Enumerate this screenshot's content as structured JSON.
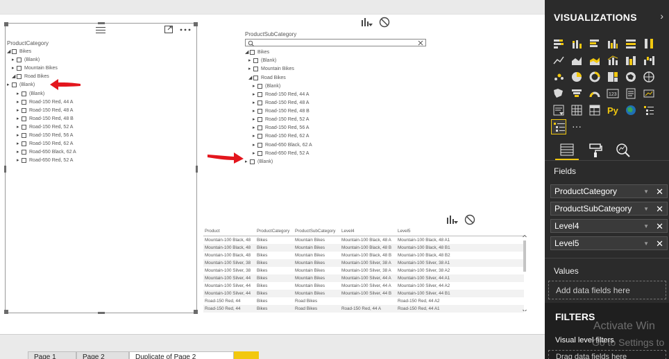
{
  "slicer1": {
    "title": "ProductCategory",
    "rows": [
      {
        "label": "Bikes",
        "caret": "◢"
      },
      {
        "label": "(Blank)",
        "caret": "▸"
      },
      {
        "label": "Mountain Bikes",
        "caret": "▸"
      },
      {
        "label": "Road Bikes",
        "caret": "◢"
      },
      {
        "label": "(Blank)",
        "caret": "▸"
      },
      {
        "label": "(Blank)",
        "caret": "▸"
      },
      {
        "label": "Road-150 Red, 44 A",
        "caret": "▸"
      },
      {
        "label": "Road-150 Red, 48 A",
        "caret": "▸"
      },
      {
        "label": "Road-150 Red, 48 B",
        "caret": "▸"
      },
      {
        "label": "Road-150 Red, 52 A",
        "caret": "▸"
      },
      {
        "label": "Road-150 Red, 56 A",
        "caret": "▸"
      },
      {
        "label": "Road-150 Red, 62 A",
        "caret": "▸"
      },
      {
        "label": "Road-650 Black, 62 A",
        "caret": "▸"
      },
      {
        "label": "Road-650 Red, 52 A",
        "caret": "▸"
      }
    ]
  },
  "slicer2": {
    "title": "ProductSubCategory",
    "search_placeholder": "",
    "rows": [
      {
        "label": "Bikes",
        "caret": "◢"
      },
      {
        "label": "(Blank)",
        "caret": "▸"
      },
      {
        "label": "Mountain Bikes",
        "caret": "▸"
      },
      {
        "label": "Road Bikes",
        "caret": "◢"
      },
      {
        "label": "(Blank)",
        "caret": "▸"
      },
      {
        "label": "Road-150 Red, 44 A",
        "caret": "▸"
      },
      {
        "label": "Road-150 Red, 48 A",
        "caret": "▸"
      },
      {
        "label": "Road-150 Red, 48 B",
        "caret": "▸"
      },
      {
        "label": "Road-150 Red, 52 A",
        "caret": "▸"
      },
      {
        "label": "Road-150 Red, 56 A",
        "caret": "▸"
      },
      {
        "label": "Road-150 Red, 62 A",
        "caret": "▸"
      },
      {
        "label": "Road-650 Black, 62 A",
        "caret": "▸"
      },
      {
        "label": "Road-650 Red, 52 A",
        "caret": "▸"
      },
      {
        "label": "(Blank)",
        "caret": "▸"
      }
    ]
  },
  "table": {
    "columns": [
      "Product",
      "ProductCategory",
      "ProductSubCategory",
      "Level4",
      "Level5"
    ],
    "rows": [
      [
        "Mountain-100 Black, 48",
        "Bikes",
        "Mountain Bikes",
        "Mountain-100 Black, 48 A",
        "Mountain-100 Black, 48 A1"
      ],
      [
        "Mountain-100 Black, 48",
        "Bikes",
        "Mountain Bikes",
        "Mountain-100 Black, 48 B",
        "Mountain-100 Black, 48 B1"
      ],
      [
        "Mountain-100 Black, 48",
        "Bikes",
        "Mountain Bikes",
        "Mountain-100 Black, 48 B",
        "Mountain-100 Black, 48 B2"
      ],
      [
        "Mountain-100 Silver, 38",
        "Bikes",
        "Mountain Bikes",
        "Mountain-100 Silver, 38 A",
        "Mountain-100 Silver, 38 A1"
      ],
      [
        "Mountain-100 Silver, 38",
        "Bikes",
        "Mountain Bikes",
        "Mountain-100 Silver, 38 A",
        "Mountain-100 Silver, 38 A2"
      ],
      [
        "Mountain-100 Silver, 44",
        "Bikes",
        "Mountain Bikes",
        "Mountain-100 Silver, 44 A",
        "Mountain-100 Silver, 44 A1"
      ],
      [
        "Mountain-100 Silver, 44",
        "Bikes",
        "Mountain Bikes",
        "Mountain-100 Silver, 44 A",
        "Mountain-100 Silver, 44 A2"
      ],
      [
        "Mountain-100 Silver, 44",
        "Bikes",
        "Mountain Bikes",
        "Mountain-100 Silver, 44 B",
        "Mountain-100 Silver, 44 B1"
      ],
      [
        "Road-150 Red, 44",
        "Bikes",
        "Road Bikes",
        "",
        "Road-150 Red, 44 A2"
      ],
      [
        "Road-150 Red, 44",
        "Bikes",
        "Road Bikes",
        "Road-150 Red, 44 A",
        "Road-150 Red, 44 A1"
      ]
    ]
  },
  "pages": {
    "tabs": [
      "Page 1",
      "Page 2",
      "Duplicate of Page 2"
    ],
    "active_index": 2
  },
  "pane": {
    "title": "VISUALIZATIONS",
    "chevron": "›",
    "fields_label": "Fields",
    "fields": [
      "ProductCategory",
      "ProductSubCategory",
      "Level4",
      "Level5"
    ],
    "values_label": "Values",
    "values_placeholder": "Add data fields here",
    "filters_label": "FILTERS",
    "visual_level_label": "Visual level filters",
    "drag_placeholder": "Drag data fields here",
    "more_label": "···",
    "watermark_line1": "Activate Win",
    "watermark_line2": "Go to Settings to"
  },
  "colors": {
    "accent": "#f2c80f",
    "pane_bg": "#2b2b2b",
    "arrow": "#e3161d"
  }
}
